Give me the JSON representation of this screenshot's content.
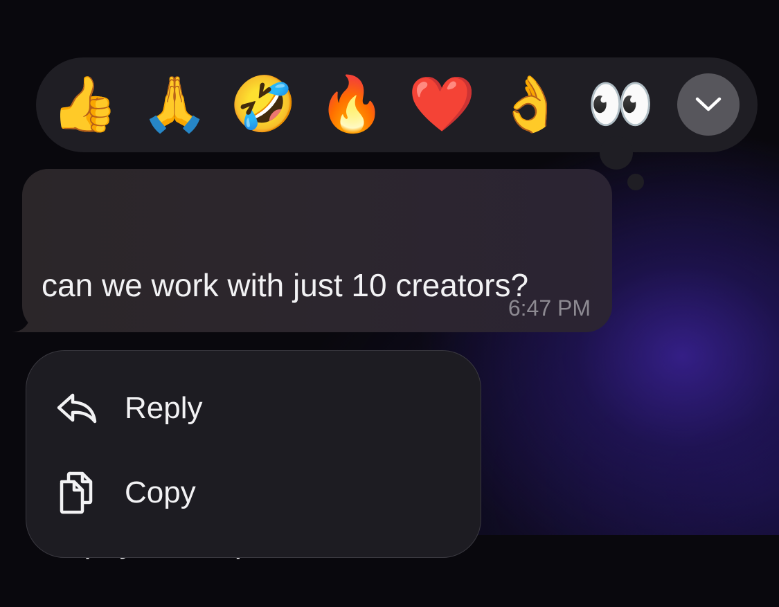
{
  "reaction_bar": {
    "reactions": [
      {
        "emoji": "👍",
        "icon": "thumbs-up-icon"
      },
      {
        "emoji": "🙏",
        "icon": "folded-hands-icon"
      },
      {
        "emoji": "🤣",
        "icon": "rolling-laughing-icon"
      },
      {
        "emoji": "🔥",
        "icon": "fire-icon"
      },
      {
        "emoji": "❤️",
        "icon": "red-heart-icon"
      },
      {
        "emoji": "👌",
        "icon": "ok-hand-icon"
      },
      {
        "emoji": "👀",
        "icon": "eyes-icon"
      }
    ],
    "more_icon": "chevron-down-icon"
  },
  "message": {
    "line1": "can we work with just 10 creators?",
    "line2": "",
    "line3": "I’d pay 50% upfront",
    "time": "6:47 PM"
  },
  "context_menu": {
    "items": [
      {
        "label": "Reply",
        "icon": "reply-arrow-icon"
      },
      {
        "label": "Copy",
        "icon": "copy-icon"
      }
    ]
  },
  "colors": {
    "bubble": "#2c262d",
    "reaction_bar": "#1f1e24",
    "menu": "#1d1c22",
    "glow": "#3a2296",
    "text": "#f2f2f4",
    "timestamp": "#8d8a92"
  }
}
